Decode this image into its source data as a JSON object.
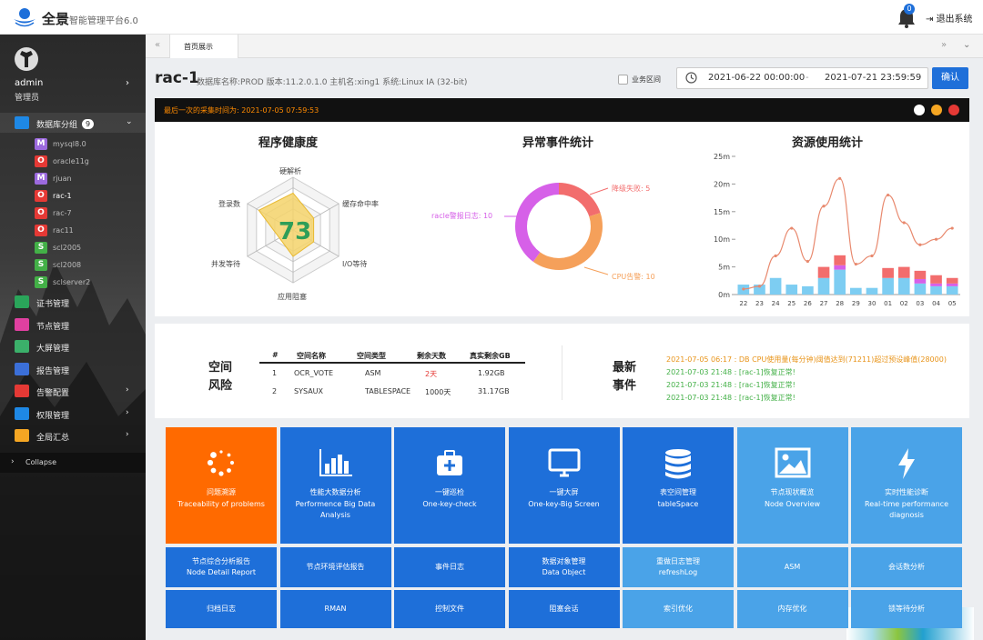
{
  "header": {
    "brand": "全景",
    "brand_sub": "智能管理平台6.0",
    "notify_count": "0",
    "logout": "退出系统"
  },
  "user": {
    "name": "admin",
    "role": "管理员"
  },
  "sidebar": {
    "db_group_label": "数据库分组",
    "db_group_count": "9",
    "db_items": [
      {
        "label": "mysql8.0",
        "icon": "M",
        "color": "#9c6ade"
      },
      {
        "label": "oracle11g",
        "icon": "O",
        "color": "#e53935"
      },
      {
        "label": "rjuan",
        "icon": "M",
        "color": "#9c6ade"
      },
      {
        "label": "rac-1",
        "icon": "O",
        "color": "#e53935"
      },
      {
        "label": "rac-7",
        "icon": "O",
        "color": "#e53935"
      },
      {
        "label": "rac11",
        "icon": "O",
        "color": "#e53935"
      },
      {
        "label": "scl2005",
        "icon": "S",
        "color": "#43b047"
      },
      {
        "label": "scl2008",
        "icon": "S",
        "color": "#43b047"
      },
      {
        "label": "sclserver2",
        "icon": "S",
        "color": "#43b047"
      }
    ],
    "menu": [
      {
        "label": "证书管理",
        "color": "#2aa55a",
        "arrow": ""
      },
      {
        "label": "节点管理",
        "color": "#e040a0",
        "arrow": ""
      },
      {
        "label": "大屏管理",
        "color": "#3bb06a",
        "arrow": ""
      },
      {
        "label": "报告管理",
        "color": "#3b6fd8",
        "arrow": ""
      },
      {
        "label": "告警配置",
        "color": "#e53935",
        "arrow": "›"
      },
      {
        "label": "权限管理",
        "color": "#1e88e5",
        "arrow": "›"
      },
      {
        "label": "全局汇总",
        "color": "#f5a623",
        "arrow": "›"
      }
    ],
    "collapse": "Collapse"
  },
  "tabs": {
    "home": "首页展示"
  },
  "db_header": {
    "title": "rac-1",
    "info": "数据库名称:PROD  版本:11.2.0.1.0  主机名:xing1  系统:Linux IA (32-bit)",
    "biz_label": "业务区间",
    "date_start": "2021-06-22 00:00:00",
    "date_sep": "-",
    "date_end": "2021-07-21 23:59:59",
    "confirm": "确认"
  },
  "collect_time": "最后一次的采集时间为: 2021-07-05 07:59:53",
  "health": {
    "title": "程序健康度",
    "score": "73",
    "axes": [
      "硬解析",
      "缓存命中率",
      "I/O等待",
      "应用阻塞",
      "并发等待",
      "登录数"
    ],
    "values": [
      0.7,
      0.45,
      0.45,
      0.5,
      0.3,
      0.75
    ]
  },
  "events_stat": {
    "title": "异常事件统计",
    "slices": [
      {
        "label": "降级失败: 5",
        "value": 5,
        "color": "#f26d6d"
      },
      {
        "label": "CPU告警: 10",
        "value": 10,
        "color": "#f5a05a"
      },
      {
        "label": "racle警报日志: 10",
        "value": 10,
        "color": "#d660e8"
      }
    ]
  },
  "resource": {
    "title": "资源使用统计"
  },
  "chart_data": {
    "type": "bar",
    "title": "资源使用统计",
    "categories": [
      "22",
      "23",
      "24",
      "25",
      "26",
      "27",
      "28",
      "29",
      "30",
      "01",
      "02",
      "03",
      "04",
      "05"
    ],
    "yticks": [
      "0m",
      "5m",
      "10m",
      "15m",
      "20m",
      "25m"
    ],
    "ylim": [
      0,
      25
    ],
    "series": [
      {
        "values": [
          1.8,
          1.8,
          3.0,
          1.8,
          1.5,
          3.0,
          4.5,
          1.2,
          1.2,
          3.0,
          3.0,
          2.0,
          1.5,
          1.5
        ],
        "color": "#7dcdf2"
      },
      {
        "values": [
          0,
          0,
          0,
          0,
          0,
          0,
          0.8,
          0,
          0,
          0,
          0,
          0.8,
          0.5,
          0.5
        ],
        "color": "#d660e8"
      },
      {
        "values": [
          0,
          0,
          0,
          0,
          0,
          2.0,
          1.8,
          0,
          0,
          1.8,
          2.0,
          1.5,
          1.5,
          1.0
        ],
        "color": "#f26d6d"
      },
      {
        "type": "line",
        "values": [
          1,
          1.5,
          7,
          12,
          6,
          16,
          21,
          5.5,
          7,
          18,
          13,
          9,
          10,
          12
        ],
        "color": "#e8896e"
      }
    ]
  },
  "space_risk": {
    "title_line1": "空间",
    "title_line2": "风险",
    "headers": [
      "#",
      "空间名称",
      "空间类型",
      "剩余天数",
      "真实剩余GB"
    ],
    "rows": [
      [
        "1",
        "OCR_VOTE",
        "ASM",
        "2天",
        "1.92GB"
      ],
      [
        "2",
        "SYSAUX",
        "TABLESPACE",
        "1000天",
        "31.17GB"
      ]
    ]
  },
  "latest_events": {
    "title_line1": "最新",
    "title_line2": "事件",
    "items": [
      {
        "text": "2021-07-05 06:17 : DB CPU使用量(每分钟)阈值达到(71211)超过预设峰值(28000)",
        "color": "#e8941a"
      },
      {
        "text": "2021-07-03 21:48 : [rac-1]恢复正常!",
        "color": "#43b047"
      },
      {
        "text": "2021-07-03 21:48 : [rac-1]恢复正常!",
        "color": "#43b047"
      },
      {
        "text": "2021-07-03 21:48 : [rac-1]恢复正常!",
        "color": "#43b047"
      }
    ]
  },
  "tiles": [
    {
      "cn": "问题溯源",
      "en": "Traceability of problems",
      "color": "#ff6a00",
      "icon": "spinner-icon"
    },
    {
      "cn": "性能大数据分析",
      "en": "Performence Big Data Analysis",
      "color": "#1e6fd9",
      "icon": "bar-chart-icon"
    },
    {
      "cn": "一键巡检",
      "en": "One-key-check",
      "color": "#1e6fd9",
      "icon": "medkit-icon"
    },
    {
      "cn": "一键大屏",
      "en": "One-key-Big Screen",
      "color": "#1e6fd9",
      "icon": "monitor-icon"
    },
    {
      "cn": "表空间管理",
      "en": "tableSpace",
      "color": "#1e6fd9",
      "icon": "database-icon"
    },
    {
      "cn": "节点现状概览",
      "en": "Node Overview",
      "color": "#4aa3e8",
      "icon": "image-icon"
    },
    {
      "cn": "实时性能诊断",
      "en": "Real-time performance diagnosis",
      "color": "#4aa3e8",
      "icon": "bolt-icon"
    }
  ],
  "row2": [
    {
      "cn": "节点综合分析报告",
      "en": "Node Detail Report",
      "color": "#1e6fd9"
    },
    {
      "cn": "节点环境评估报告",
      "en": "",
      "color": "#1e6fd9"
    },
    {
      "cn": "事件日志",
      "en": "",
      "color": "#1e6fd9"
    },
    {
      "cn": "数据对象管理",
      "en": "Data Object",
      "color": "#1e6fd9"
    },
    {
      "cn": "重做日志管理",
      "en": "refreshLog",
      "color": "#4aa3e8"
    },
    {
      "cn": "ASM",
      "en": "",
      "color": "#4aa3e8"
    },
    {
      "cn": "会话数分析",
      "en": "",
      "color": "#4aa3e8"
    }
  ],
  "row3": [
    {
      "cn": "归档日志",
      "color": "#1e6fd9"
    },
    {
      "cn": "RMAN",
      "color": "#1e6fd9"
    },
    {
      "cn": "控制文件",
      "color": "#1e6fd9"
    },
    {
      "cn": "阻塞会话",
      "color": "#1e6fd9"
    },
    {
      "cn": "索引优化",
      "color": "#4aa3e8"
    },
    {
      "cn": "内存优化",
      "color": "#4aa3e8"
    },
    {
      "cn": "锁等待分析",
      "color": "#4aa3e8"
    }
  ]
}
